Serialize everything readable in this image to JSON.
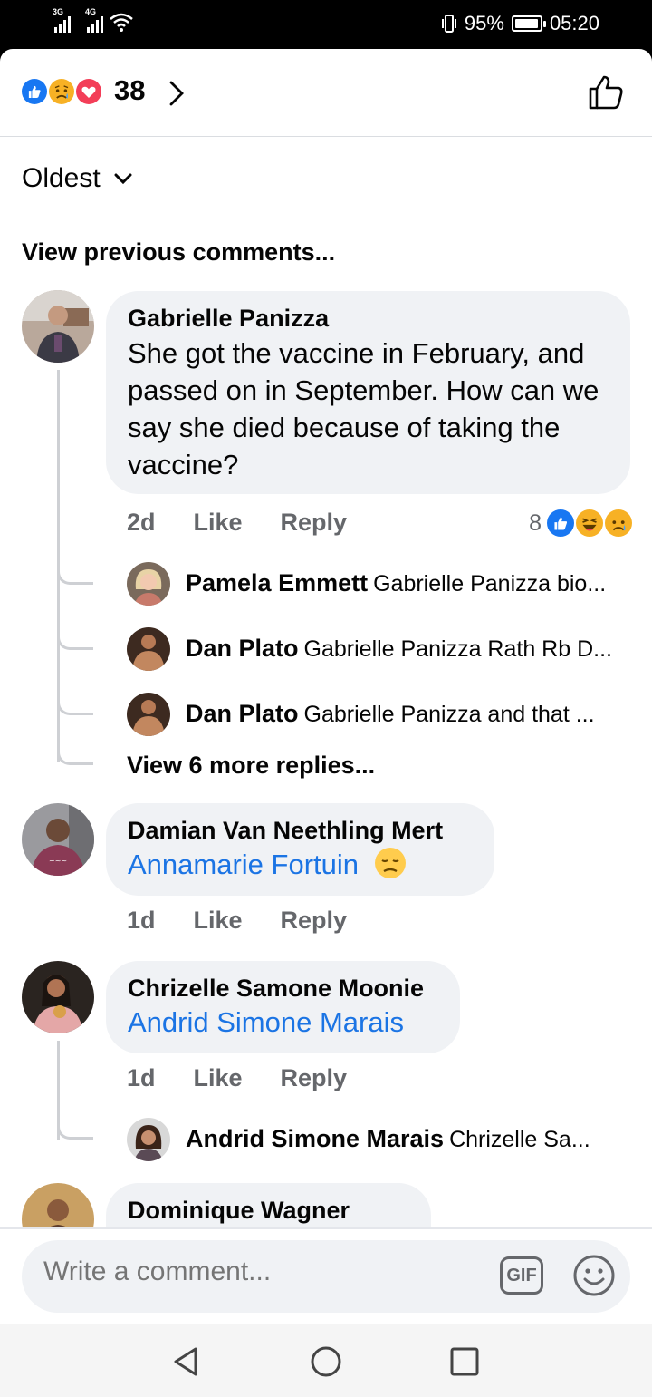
{
  "status_bar": {
    "net1": "3G",
    "net2": "4G",
    "battery": "95%",
    "battery_level": 0.95,
    "time": "05:20"
  },
  "reactions": {
    "count": "38",
    "icons": [
      "like",
      "sad",
      "love"
    ]
  },
  "sort": {
    "label": "Oldest"
  },
  "view_previous": "View previous comments...",
  "comments": [
    {
      "name": "Gabrielle Panizza",
      "text": "She got the vaccine in February, and passed on in September. How can we say she died because of taking the vaccine?",
      "time": "2d",
      "like": "Like",
      "reply": "Reply",
      "reaction_count": "8",
      "reaction_icons": [
        "like",
        "haha",
        "sad"
      ],
      "replies": [
        {
          "name": "Pamela Emmett",
          "text": "Gabrielle Panizza bio..."
        },
        {
          "name": "Dan Plato",
          "text": "Gabrielle Panizza Rath Rb D..."
        },
        {
          "name": "Dan Plato",
          "text": "Gabrielle Panizza and that ..."
        }
      ],
      "more_replies": "View 6 more replies..."
    },
    {
      "name": "Damian Van Neethling Mert",
      "mention": "Annamarie Fortuin",
      "emoji": "disappointed-face",
      "time": "1d",
      "like": "Like",
      "reply": "Reply"
    },
    {
      "name": "Chrizelle Samone Moonie",
      "mention": "Andrid Simone Marais",
      "time": "1d",
      "like": "Like",
      "reply": "Reply",
      "replies": [
        {
          "name": "Andrid Simone Marais",
          "text": "Chrizelle Sa..."
        }
      ]
    },
    {
      "name": "Dominique Wagner"
    }
  ],
  "composer": {
    "placeholder": "Write a comment...",
    "gif_label": "GIF"
  },
  "colors": {
    "accent": "#1b74e4",
    "like_blue": "#1877f2",
    "love_red": "#f33e58",
    "bubble": "#f0f2f5",
    "muted": "#65676b"
  }
}
